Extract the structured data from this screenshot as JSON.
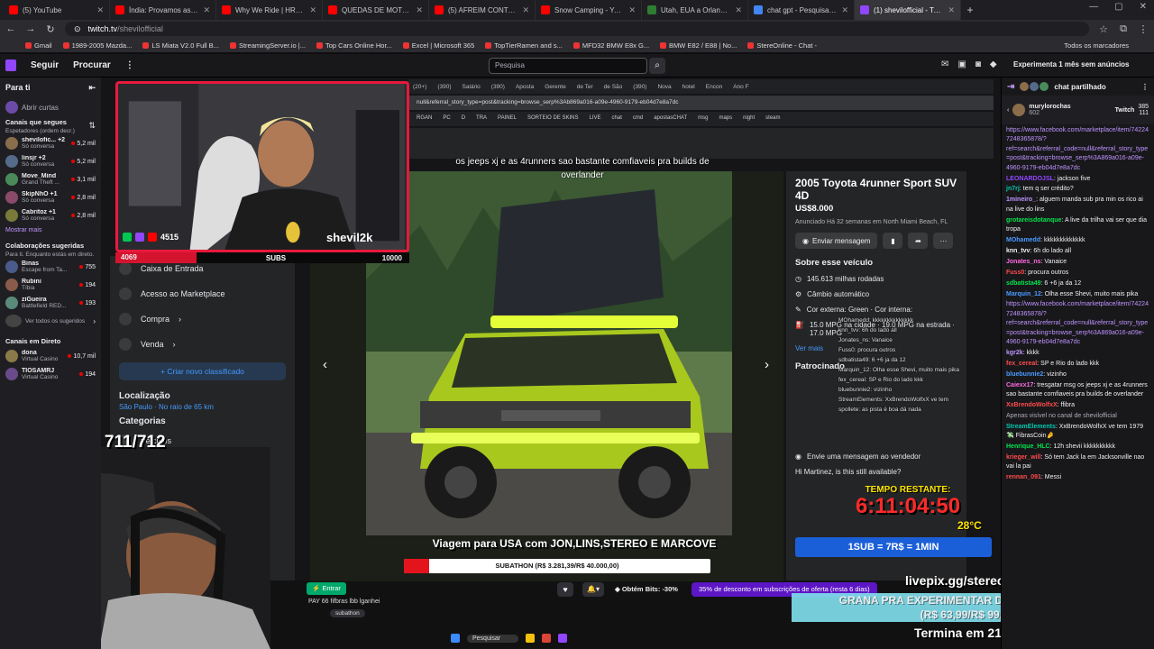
{
  "browser": {
    "tabs": [
      {
        "label": "(5) YouTube",
        "color": "#ff0000"
      },
      {
        "label": "Índia: Provamos as Comidas de Rua",
        "color": "#ff0000"
      },
      {
        "label": "Why We Ride | HRC Rally Raid",
        "color": "#ff0000"
      },
      {
        "label": "QUEDAS DE MOTO (EP. 163)",
        "color": "#ff0000"
      },
      {
        "label": "(5) AFREIM CONTOU PORQUE",
        "color": "#ff0000"
      },
      {
        "label": "Snow Camping - YouTube",
        "color": "#ff0000"
      },
      {
        "label": "Utah, EUA a Orlando, Flórida",
        "color": "#2e7d32"
      },
      {
        "label": "chat gpt - Pesquisa Google",
        "color": "#4285f4"
      },
      {
        "label": "(1) shevilofficial - Twitch",
        "color": "#9146ff",
        "active": true
      }
    ],
    "new_tab": "+",
    "url_host": "twitch.tv",
    "url_path": "/shevilofficial",
    "bookmarks": [
      "Gmail",
      "1989-2005 Mazda...",
      "LS Miata V2.0 Full B...",
      "StreamingServer.io |...",
      "Top Cars Online Hor...",
      "Excel | Microsoft 365",
      "TopTierRamen and s...",
      "MFD32 BMW E8x G...",
      "BMW E82 / E88 | No...",
      "StereOnline - Chat -"
    ],
    "bookmarks_all": "Todos os marcadores"
  },
  "twitch_nav": {
    "follow": "Seguir",
    "browse": "Procurar",
    "more": "⋮",
    "search_placeholder": "Pesquisa",
    "promo": "Experimenta 1 mês sem anúncios"
  },
  "sidebar": {
    "title": "Para ti",
    "collapse": "⇤",
    "open_curtains": "Abrir curtas",
    "followed_title": "Canais que segues",
    "followed_sub": "Espetadores (ordem decr.)",
    "followed": [
      {
        "name": "shevilofic... +2",
        "game": "Só conversa",
        "viewers": "5,2 mil",
        "color": "#8a6d4a"
      },
      {
        "name": "linsjr +2",
        "game": "Só conversa",
        "viewers": "5,2 mil",
        "color": "#556b8a"
      },
      {
        "name": "Move_Mind",
        "game": "Grand Theft ...",
        "viewers": "3,1 mil",
        "color": "#4a8a5a"
      },
      {
        "name": "SkipNhO +1",
        "game": "Só conversa",
        "viewers": "2,8 mil",
        "color": "#8a4a6a"
      },
      {
        "name": "Cabritoz +1",
        "game": "Só conversa",
        "viewers": "2,8 mil",
        "color": "#7a7a3a"
      }
    ],
    "show_more": "Mostrar mais",
    "collab_title": "Colaborações sugeridas",
    "collab_sub": "Para ti. Enquanto estás em direto.",
    "collabs": [
      {
        "name": "Binas",
        "game": "Escape from Ta...",
        "viewers": "755",
        "color": "#4a5a8a"
      },
      {
        "name": "Rubini",
        "game": "Tíbia",
        "viewers": "194",
        "color": "#8a5a4a"
      },
      {
        "name": "ziGueira",
        "game": "Battlefield RED...",
        "viewers": "193",
        "color": "#5a8a7a"
      }
    ],
    "see_all": "Ver todos os sugeridos",
    "live_title": "Canais em Direto",
    "live": [
      {
        "name": "dona",
        "game": "Virtual Casino",
        "viewers": "10,7 mil",
        "color": "#8a7a4a"
      },
      {
        "name": "TIOSAMRJ",
        "game": "Virtual Casino",
        "viewers": "194",
        "color": "#6a4a8a"
      }
    ]
  },
  "fb": {
    "menu": [
      "Caixa de Entrada",
      "Acesso ao Marketplace",
      "Compra",
      "Venda"
    ],
    "create": "+ Criar novo classificado",
    "location_title": "Localização",
    "location": "São Paulo · No raio de 65 km",
    "categories_title": "Categorias",
    "category": "Veículos",
    "listing_title": "2005 Toyota 4runner Sport SUV 4D",
    "price": "US$8.000",
    "posted": "Anunciado Há 32 semanas em North Miami Beach, FL",
    "message_btn": "Enviar mensagem",
    "about_title": "Sobre esse veículo",
    "mileage": "145.613 milhas rodadas",
    "transmission": "Câmbio automático",
    "colors": "Cor externa: Green · Cor interna:",
    "mpg": "15.0 MPG na cidade · 19.0 MPG na estrada · 17.0 MPG",
    "see_more": "Ver mais",
    "sponsored": "Patrocinado",
    "seller_msg": "Envie uma mensagem ao vendedor",
    "seller_hint": "Hi Martinez, is this still available?"
  },
  "stream": {
    "caption": "os jeeps xj e as 4runners sao bastante comfiaveis pra builds de overlander",
    "webcam_subs_count": "4515",
    "streamer_handle": "shevil2k",
    "bar_left": "4069",
    "bar_mid": "SUBS",
    "bar_right": "10000",
    "sub_goal": "SUB GOAL: 711/712",
    "timer_label": "TEMPO RESTANTE:",
    "timer_value": "6:11:04:50",
    "temperature": "28°C",
    "sub_rate": "1SUB = 7R$ = 1MIN",
    "trip_banner": "Viagem para USA com JON,LINS,STEREO E MARCOVE",
    "subathon": "SUBATHON (R$ 3.281,39/R$ 40.000,00)",
    "subathon_progress": 0.082,
    "overlay_chat": [
      "MOhamedd: kkkkkkkkkkkkkk",
      "knn_tvv: 6h do lado all",
      "Jonates_ns: Vanaice",
      "Fuss0: procura outros",
      "sdbatista49: 6 +6 ja da 12",
      "Marquin_12: Olha esse Shevi, muito mais pika",
      "fex_cereal: SP e Rio do lado kkk",
      "bluebunnie2: vizinho",
      "StreamElements: XxBrendoWolfxX ve tem",
      "spollete: as pista é boa dá nada"
    ],
    "livepix": "livepix.gg/stereonline",
    "grana_1": "GRANA PRA EXPERIMENTAR DROGA NA GRINGA",
    "grana_2": "(R$ 63,99/R$ 99,99)",
    "termina": "Termina em 21 dias"
  },
  "below_stream": {
    "entrar": "⚡ Entrar",
    "bits": "◆ Obtém Bits: -30%",
    "discount": "35% de desconto em subscrições de oferta (resta 6 dias)",
    "heart": "♥",
    "bell": "🔔▾",
    "sublower": "PAY 66 fifbras lbb lganhei",
    "subathon_tag": "subathon"
  },
  "chat": {
    "collapse": "⇥",
    "shared": "chat partilhado",
    "shared_user": "murylorochas",
    "shared_count": "602",
    "shared_twitch": "Twitch",
    "shared_n1": "385",
    "shared_n2": "111",
    "lines": [
      {
        "u": "",
        "t": "https://www.facebook.com/marketplace/item/742247248365878/?ref=search&referral_code=null&referral_story_type=post&tracking=browse_serp%3A869a016-a09e-4960-9179-eb04d7e8a7dc",
        "c": "#bf94ff",
        "link": true
      },
      {
        "u": "LEONARDOJSL",
        "t": ": jackson five",
        "c": "#9146ff"
      },
      {
        "u": "jn7rj",
        "t": ": tem q ser crédito?",
        "c": "#00c8af"
      },
      {
        "u": "1mineiro_",
        "t": ": alguem manda sub pra min os rico ai na live do lins",
        "c": "#bf94ff"
      },
      {
        "u": "grotareisdotanque",
        "t": ": A live da trilha vai ser que dia tropa",
        "c": "#00e64b"
      },
      {
        "u": "MOhamedd",
        "t": ": kkkkkkkkkkkkk",
        "c": "#4a9bff"
      },
      {
        "u": "knn_tvv",
        "t": ": 6h do lado all",
        "c": "#efeff1"
      },
      {
        "u": "Jonates_ns",
        "t": ": Vanaice",
        "c": "#ff6ae0"
      },
      {
        "u": "Fuss0",
        "t": ": procura outros",
        "c": "#ff4b4b"
      },
      {
        "u": "sdbatista49",
        "t": ": 6 +6 ja da 12",
        "c": "#00e64b"
      },
      {
        "u": "Marquin_12",
        "t": ": Olha esse Shevi, muito mais pika",
        "c": "#4a9bff"
      },
      {
        "u": "",
        "t": "https://www.facebook.com/marketplace/item/742247248365878/?ref=search&referral_code=null&referral_story_type=post&tracking=browse_serp%3A869a016-a09e-4960-9179-eb04d7e8a7dc",
        "c": "#bf94ff",
        "link": true
      },
      {
        "u": "kgr2k",
        "t": ": kkkk",
        "c": "#bf94ff"
      },
      {
        "u": "fex_cereal",
        "t": ": SP e Rio do lado kkk",
        "c": "#ff4b4b"
      },
      {
        "u": "bluebunnie2",
        "t": ": vizinho",
        "c": "#4a9bff"
      },
      {
        "u": "Caiexx17",
        "t": ": tresgatar msg os jeeps xj e as 4runners sao bastante comfiaveis pra builds de overlander",
        "c": "#ff6ae0"
      },
      {
        "u": "XxBrendoWolfxX",
        "t": ": ffibra",
        "c": "#ff4b4b"
      },
      {
        "u": "",
        "t": "Apenas visível no canal de shevilofficial",
        "c": "#adadb8",
        "sys": true
      },
      {
        "u": "StreamElements",
        "t": ": XxBrendoWolfxX ve tem 1979 💸 FibrasCoin🤌",
        "c": "#00c8af"
      },
      {
        "u": "Henrique_HLC",
        "t": ": 12h shevii kkkkkkkkkk",
        "c": "#00e64b"
      },
      {
        "u": "krieger_will",
        "t": ": Só tem Jack la em Jacksonville nao vai la pai",
        "c": "#ff4b4b"
      },
      {
        "u": "rennan_091",
        "t": ": Messi",
        "c": "#ff4b4b"
      }
    ]
  },
  "taskbar": {
    "search": "Pesquisar",
    "lang": "POR INTL",
    "clock": "20:44 26/12/2025"
  }
}
